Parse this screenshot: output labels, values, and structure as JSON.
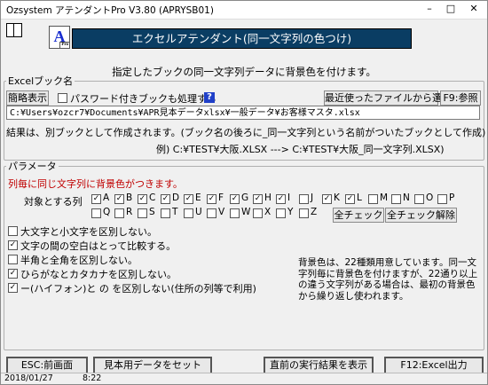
{
  "window": {
    "title": "Ozsystem アテンダントPro V3.80 (APRYSB01)"
  },
  "header": {
    "logo_letter": "A",
    "logo_small": "Pro",
    "banner": "エクセルアテンダント(同一文字列の色つけ)",
    "subtitle": "指定したブックの同一文字列データに背景色を付けます。"
  },
  "excel_group": {
    "legend": "Excelブック名",
    "browse_label": "簡略表示",
    "password_label": "パスワード付きブックも処理する",
    "password_checked": false,
    "help": "?",
    "recent_label": "最近使ったファイルから選択",
    "f9_label": "F9:参照",
    "path": "C:¥Users¥ozcr7¥Documents¥APR見本データxlsx¥一般データ¥お客様マスタ.xlsx",
    "result_note": "結果は、別ブックとして作成されます。(ブック名の後ろに_同一文字列という名前がついたブックとして作成)",
    "example": "例) C:¥TEST¥大阪.XLSX ---> C:¥TEST¥大阪_同一文字列.XLSX)"
  },
  "params": {
    "legend": "パラメータ",
    "red_note": "列毎に同じ文字列に背景色がつきます。",
    "target_label": "対象とする列",
    "columns_row1": [
      {
        "l": "A",
        "c": true
      },
      {
        "l": "B",
        "c": true
      },
      {
        "l": "C",
        "c": true
      },
      {
        "l": "D",
        "c": true
      },
      {
        "l": "E",
        "c": true
      },
      {
        "l": "F",
        "c": true
      },
      {
        "l": "G",
        "c": true
      },
      {
        "l": "H",
        "c": true
      },
      {
        "l": "I",
        "c": true
      },
      {
        "l": "J",
        "c": false
      },
      {
        "l": "K",
        "c": true
      },
      {
        "l": "L",
        "c": true
      },
      {
        "l": "M",
        "c": false
      },
      {
        "l": "N",
        "c": false
      },
      {
        "l": "O",
        "c": false
      },
      {
        "l": "P",
        "c": false
      }
    ],
    "columns_row2": [
      {
        "l": "Q",
        "c": false
      },
      {
        "l": "R",
        "c": false
      },
      {
        "l": "S",
        "c": false
      },
      {
        "l": "T",
        "c": false
      },
      {
        "l": "U",
        "c": false
      },
      {
        "l": "V",
        "c": false
      },
      {
        "l": "W",
        "c": false
      },
      {
        "l": "X",
        "c": false
      },
      {
        "l": "Y",
        "c": false
      },
      {
        "l": "Z",
        "c": false
      }
    ],
    "check_all": "全チェック",
    "uncheck_all": "全チェック解除",
    "options": [
      {
        "label": "大文字と小文字を区別しない。",
        "checked": false
      },
      {
        "label": "文字の間の空白はとって比較する。",
        "checked": true
      },
      {
        "label": "半角と全角を区別しない。",
        "checked": false
      },
      {
        "label": "ひらがなとカタカナを区別しない。",
        "checked": true
      },
      {
        "label": "ー(ハイフォン)と の を区別しない(住所の列等で利用)",
        "checked": true
      }
    ],
    "note": "背景色は、22種類用意しています。同一文字列毎に背景色を付けますが、22通り以上の違う文字列がある場合は、最初の背景色から繰り返し使われます。"
  },
  "footer": {
    "esc": "ESC:前画面",
    "sample": "見本用データをセット",
    "last_result": "直前の実行結果を表示",
    "f12": "F12:Excel出力",
    "date": "2018/01/27",
    "time": "8:22"
  }
}
